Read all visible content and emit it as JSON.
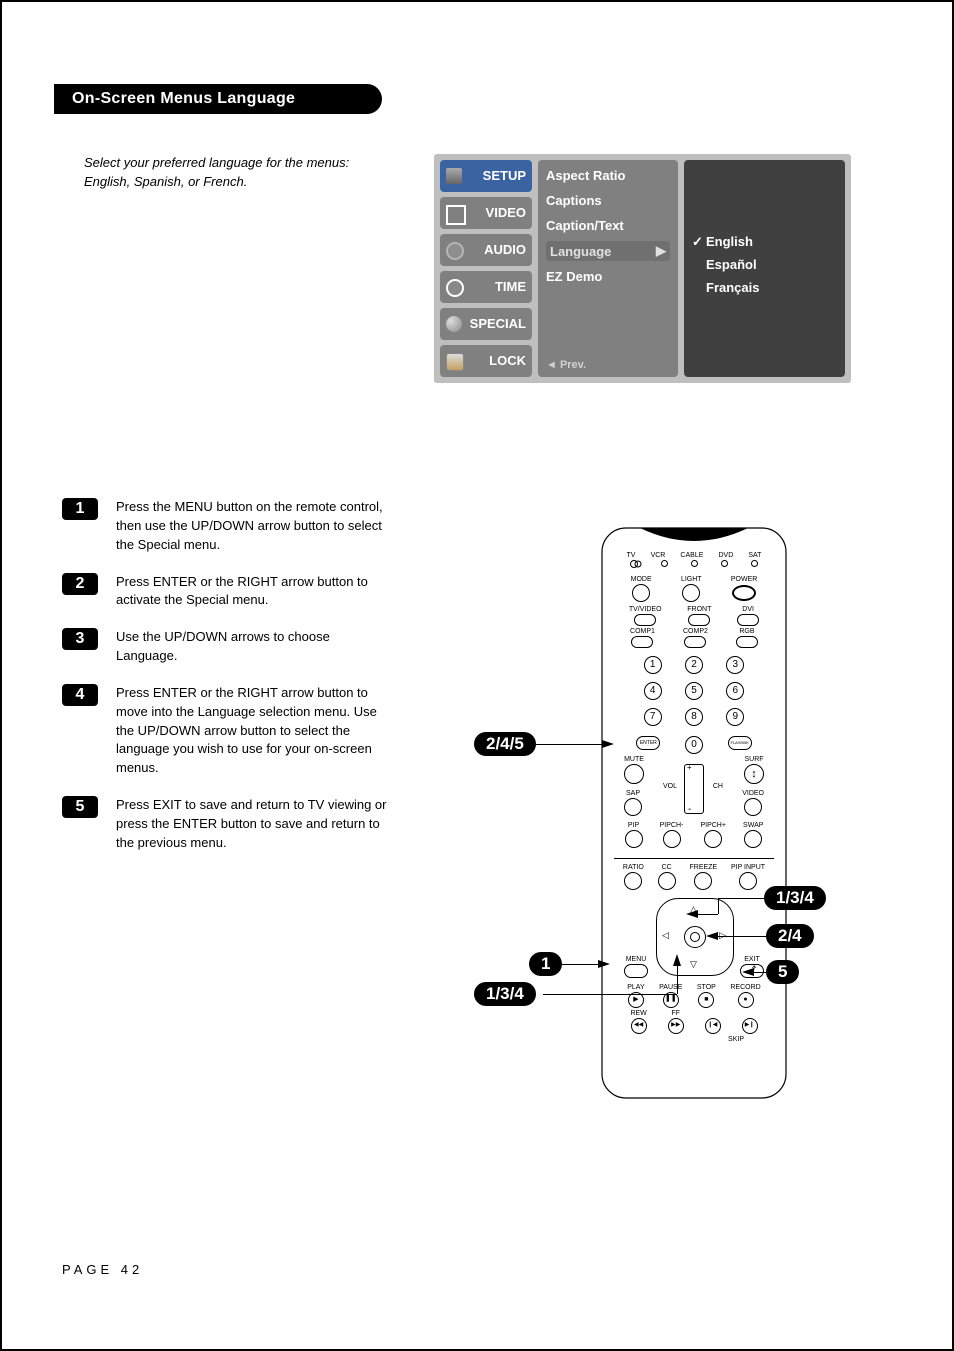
{
  "title": "On-Screen Menus Language",
  "intro": "Select your preferred language for the menus: English, Spanish, or French.",
  "osd": {
    "tabs": [
      "SETUP",
      "VIDEO",
      "AUDIO",
      "TIME",
      "SPECIAL",
      "LOCK"
    ],
    "items": [
      "Aspect Ratio",
      "Captions",
      "Caption/Text",
      "Language",
      "EZ Demo"
    ],
    "selected_item": "Language",
    "options": [
      "English",
      "Español",
      "Français"
    ],
    "selected_option": "English",
    "prev": "◄ Prev."
  },
  "steps": [
    {
      "n": "1",
      "text": "Press the MENU button on the remote control, then use the UP/DOWN arrow button to select the Special menu."
    },
    {
      "n": "2",
      "text": "Press ENTER or the RIGHT arrow button to activate the Special menu."
    },
    {
      "n": "3",
      "text": "Use the UP/DOWN arrows to choose Language."
    },
    {
      "n": "4",
      "text": "Press ENTER or the RIGHT arrow button to move into the Language selection menu. Use the UP/DOWN arrow button to select the language you wish to use for your on-screen menus."
    },
    {
      "n": "5",
      "text": "Press EXIT to save and return to TV viewing or press the ENTER button to save and return to the previous menu."
    }
  ],
  "remote": {
    "top_row": [
      "TV",
      "VCR",
      "CABLE",
      "DVD",
      "SAT"
    ],
    "row1_labels": [
      "MODE",
      "LIGHT",
      "POWER"
    ],
    "row2_labels": [
      "TV/VIDEO",
      "FRONT",
      "DVI"
    ],
    "row3_labels": [
      "COMP1",
      "COMP2",
      "RGB"
    ],
    "numpad": [
      "1",
      "2",
      "3",
      "4",
      "5",
      "6",
      "7",
      "8",
      "9"
    ],
    "row_enter": [
      "ENTER",
      "0",
      "FLASHBK"
    ],
    "mute": "MUTE",
    "surf": "SURF",
    "sap": "SAP",
    "video": "VIDEO",
    "vol": "VOL",
    "ch": "CH",
    "pip_row": [
      "PIP",
      "PIPCH-",
      "PIPCH+",
      "SWAP"
    ],
    "row_ratio": [
      "RATIO",
      "CC",
      "FREEZE",
      "PIP INPUT"
    ],
    "menu": "MENU",
    "exit": "EXIT",
    "playback": [
      "PLAY",
      "PAUSE",
      "STOP",
      "RECORD"
    ],
    "rew": "REW",
    "ff": "FF",
    "skip": "SKIP"
  },
  "callouts": {
    "c1": "2/4/5",
    "c2": "1",
    "c3": "1/3/4",
    "c4": "1/3/4",
    "c5": "2/4",
    "c6": "5"
  },
  "footer_label": "PAGE",
  "footer_num": "42"
}
